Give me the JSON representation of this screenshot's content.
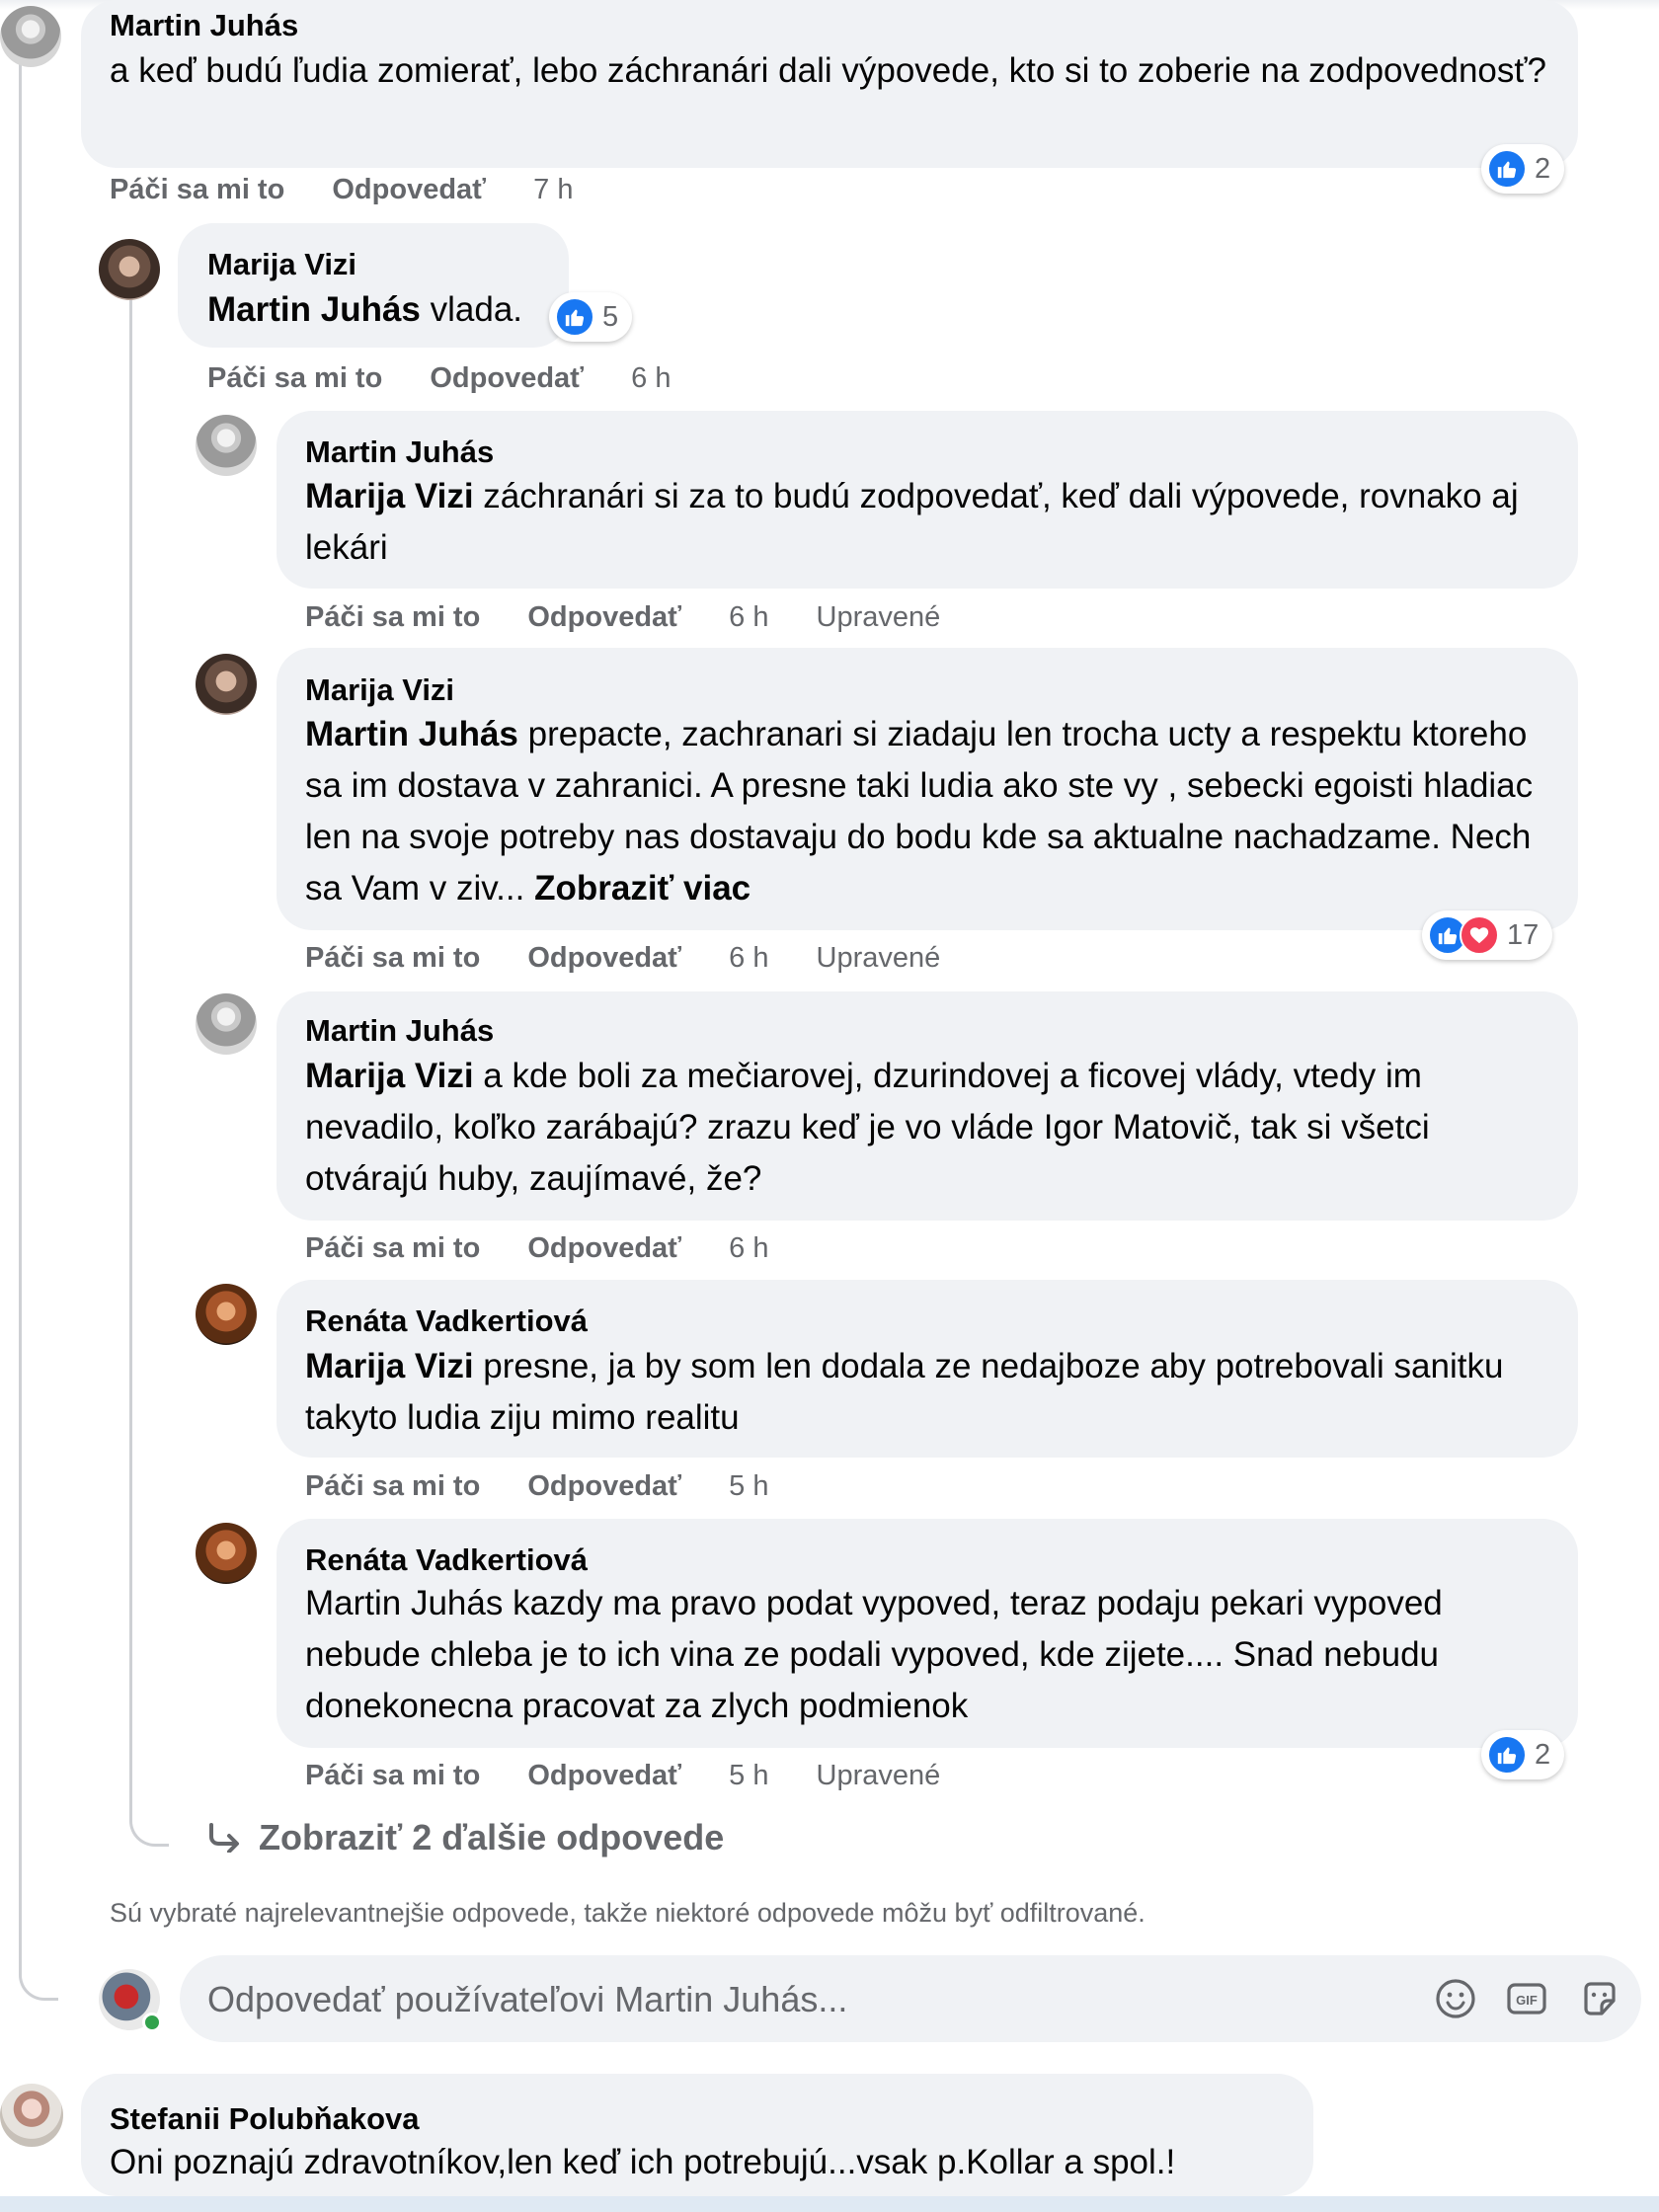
{
  "comments": [
    {
      "author": "Martin Juhás",
      "text": "a keď budú ľudia zomierať, lebo záchranári dali výpovede, kto si to zoberie na zodpovednosť?",
      "like": "Páči sa mi to",
      "reply": "Odpovedať",
      "time": "7 h",
      "reactions": "2"
    },
    {
      "author": "Marija Vizi",
      "tag": "Martin Juhás",
      "text": " vlada.",
      "like": "Páči sa mi to",
      "reply": "Odpovedať",
      "time": "6 h",
      "reactions": "5"
    },
    {
      "author": "Martin Juhás",
      "tag": "Marija Vizi",
      "text": " záchranári si za to budú zodpovedať, keď dali výpovede, rovnako aj lekári",
      "like": "Páči sa mi to",
      "reply": "Odpovedať",
      "time": "6 h",
      "edited": "Upravené"
    },
    {
      "author": "Marija Vizi",
      "tag": "Martin Juhás",
      "text": " prepacte, zachranari si ziadaju len trocha ucty a respektu ktoreho sa im dostava v zahranici. A presne taki ludia ako ste vy , sebecki egoisti hladiac len na svoje potreby nas dostavaju do bodu kde sa aktualne nachadzame. Nech sa Vam v ziv... ",
      "see_more": "Zobraziť viac",
      "like": "Páči sa mi to",
      "reply": "Odpovedať",
      "time": "6 h",
      "edited": "Upravené",
      "reactions": "17"
    },
    {
      "author": "Martin Juhás",
      "tag": "Marija Vizi",
      "text": " a kde boli za mečiarovej, dzurindovej a ficovej vlády, vtedy im nevadilo, koľko zarábajú? zrazu keď je vo vláde Igor Matovič, tak si všetci otvárajú huby, zaujímavé, že?",
      "like": "Páči sa mi to",
      "reply": "Odpovedať",
      "time": "6 h"
    },
    {
      "author": "Renáta Vadkertiová",
      "tag": "Marija Vizi",
      "text": " presne, ja by som len dodala ze nedajboze aby potrebovali sanitku takyto ludia ziju mimo realitu",
      "like": "Páči sa mi to",
      "reply": "Odpovedať",
      "time": "5 h"
    },
    {
      "author": "Renáta Vadkertiová",
      "text": "Martin Juhás kazdy ma pravo podat vypoved, teraz podaju pekari vypoved nebude chleba je to ich vina ze podali vypoved, kde zijete.... Snad nebudu donekonecna pracovat za zlych podmienok",
      "like": "Páči sa mi to",
      "reply": "Odpovedať",
      "time": "5 h",
      "edited": "Upravené",
      "reactions": "2"
    }
  ],
  "view_more_replies": "Zobraziť 2 ďalšie odpovede",
  "filter_note": "Sú vybraté najrelevantnejšie odpovede, takže niektoré odpovede môžu byť odfiltrované.",
  "reply_box": {
    "placeholder": "Odpovedať používateľovi Martin Juhás..."
  },
  "next_comment": {
    "author": "Stefanii Polubňakova",
    "text": "Oni poznajú zdravotníkov,len keď ich potrebujú...vsak p.Kollar a spol.!"
  },
  "colors": {
    "bubble": "#f0f2f5",
    "meta_text": "#65676b",
    "like_blue": "#1877f2",
    "love_red": "#f33e58",
    "thread_line": "#ced0d4"
  }
}
